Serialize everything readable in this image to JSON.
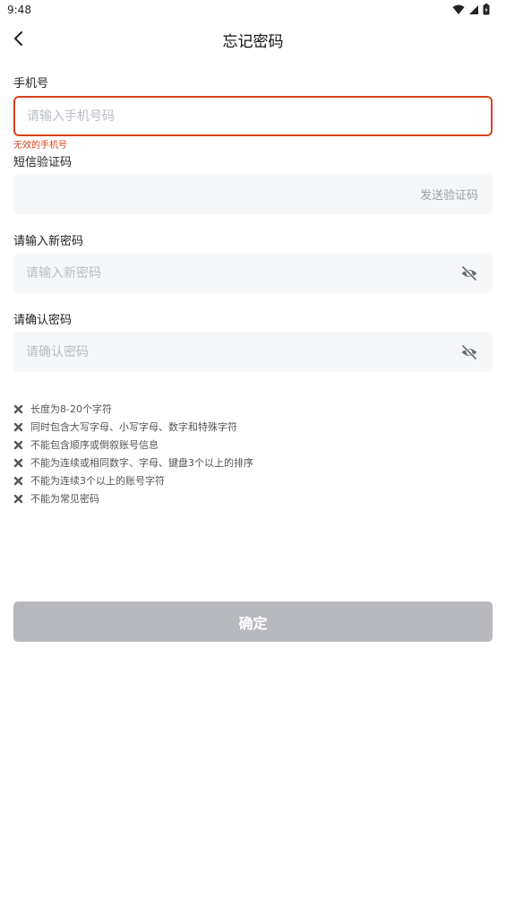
{
  "status_bar": {
    "time": "9:48",
    "icons": [
      "wifi-icon",
      "signal-icon",
      "battery-icon"
    ]
  },
  "nav": {
    "title": "忘记密码",
    "back_icon": "chevron-left-icon"
  },
  "phone": {
    "label": "手机号",
    "placeholder": "请输入手机号码",
    "value": "",
    "error": "无效的手机号"
  },
  "sms": {
    "label": "短信验证码",
    "value": "",
    "send_label": "发送验证码"
  },
  "new_password": {
    "label": "请输入新密码",
    "placeholder": "请输入新密码",
    "value": "",
    "visibility_icon": "eye-off-icon"
  },
  "confirm_password": {
    "label": "请确认密码",
    "placeholder": "请确认密码",
    "value": "",
    "visibility_icon": "eye-off-icon"
  },
  "rules": [
    {
      "text": "长度为8-20个字符",
      "icon": "x-icon"
    },
    {
      "text": "同时包含大写字母、小写字母、数字和特殊字符",
      "icon": "x-icon"
    },
    {
      "text": "不能包含顺序或倒叙账号信息",
      "icon": "x-icon"
    },
    {
      "text": "不能为连续或相同数字、字母、键盘3个以上的排序",
      "icon": "x-icon"
    },
    {
      "text": "不能为连续3个以上的账号字符",
      "icon": "x-icon"
    },
    {
      "text": "不能为常见密码",
      "icon": "x-icon"
    }
  ],
  "submit": {
    "label": "确定"
  },
  "colors": {
    "error": "#d9441f",
    "input_bg": "#f6f7f9",
    "button_disabled": "#b8b9be",
    "placeholder": "#b9bcc4"
  }
}
